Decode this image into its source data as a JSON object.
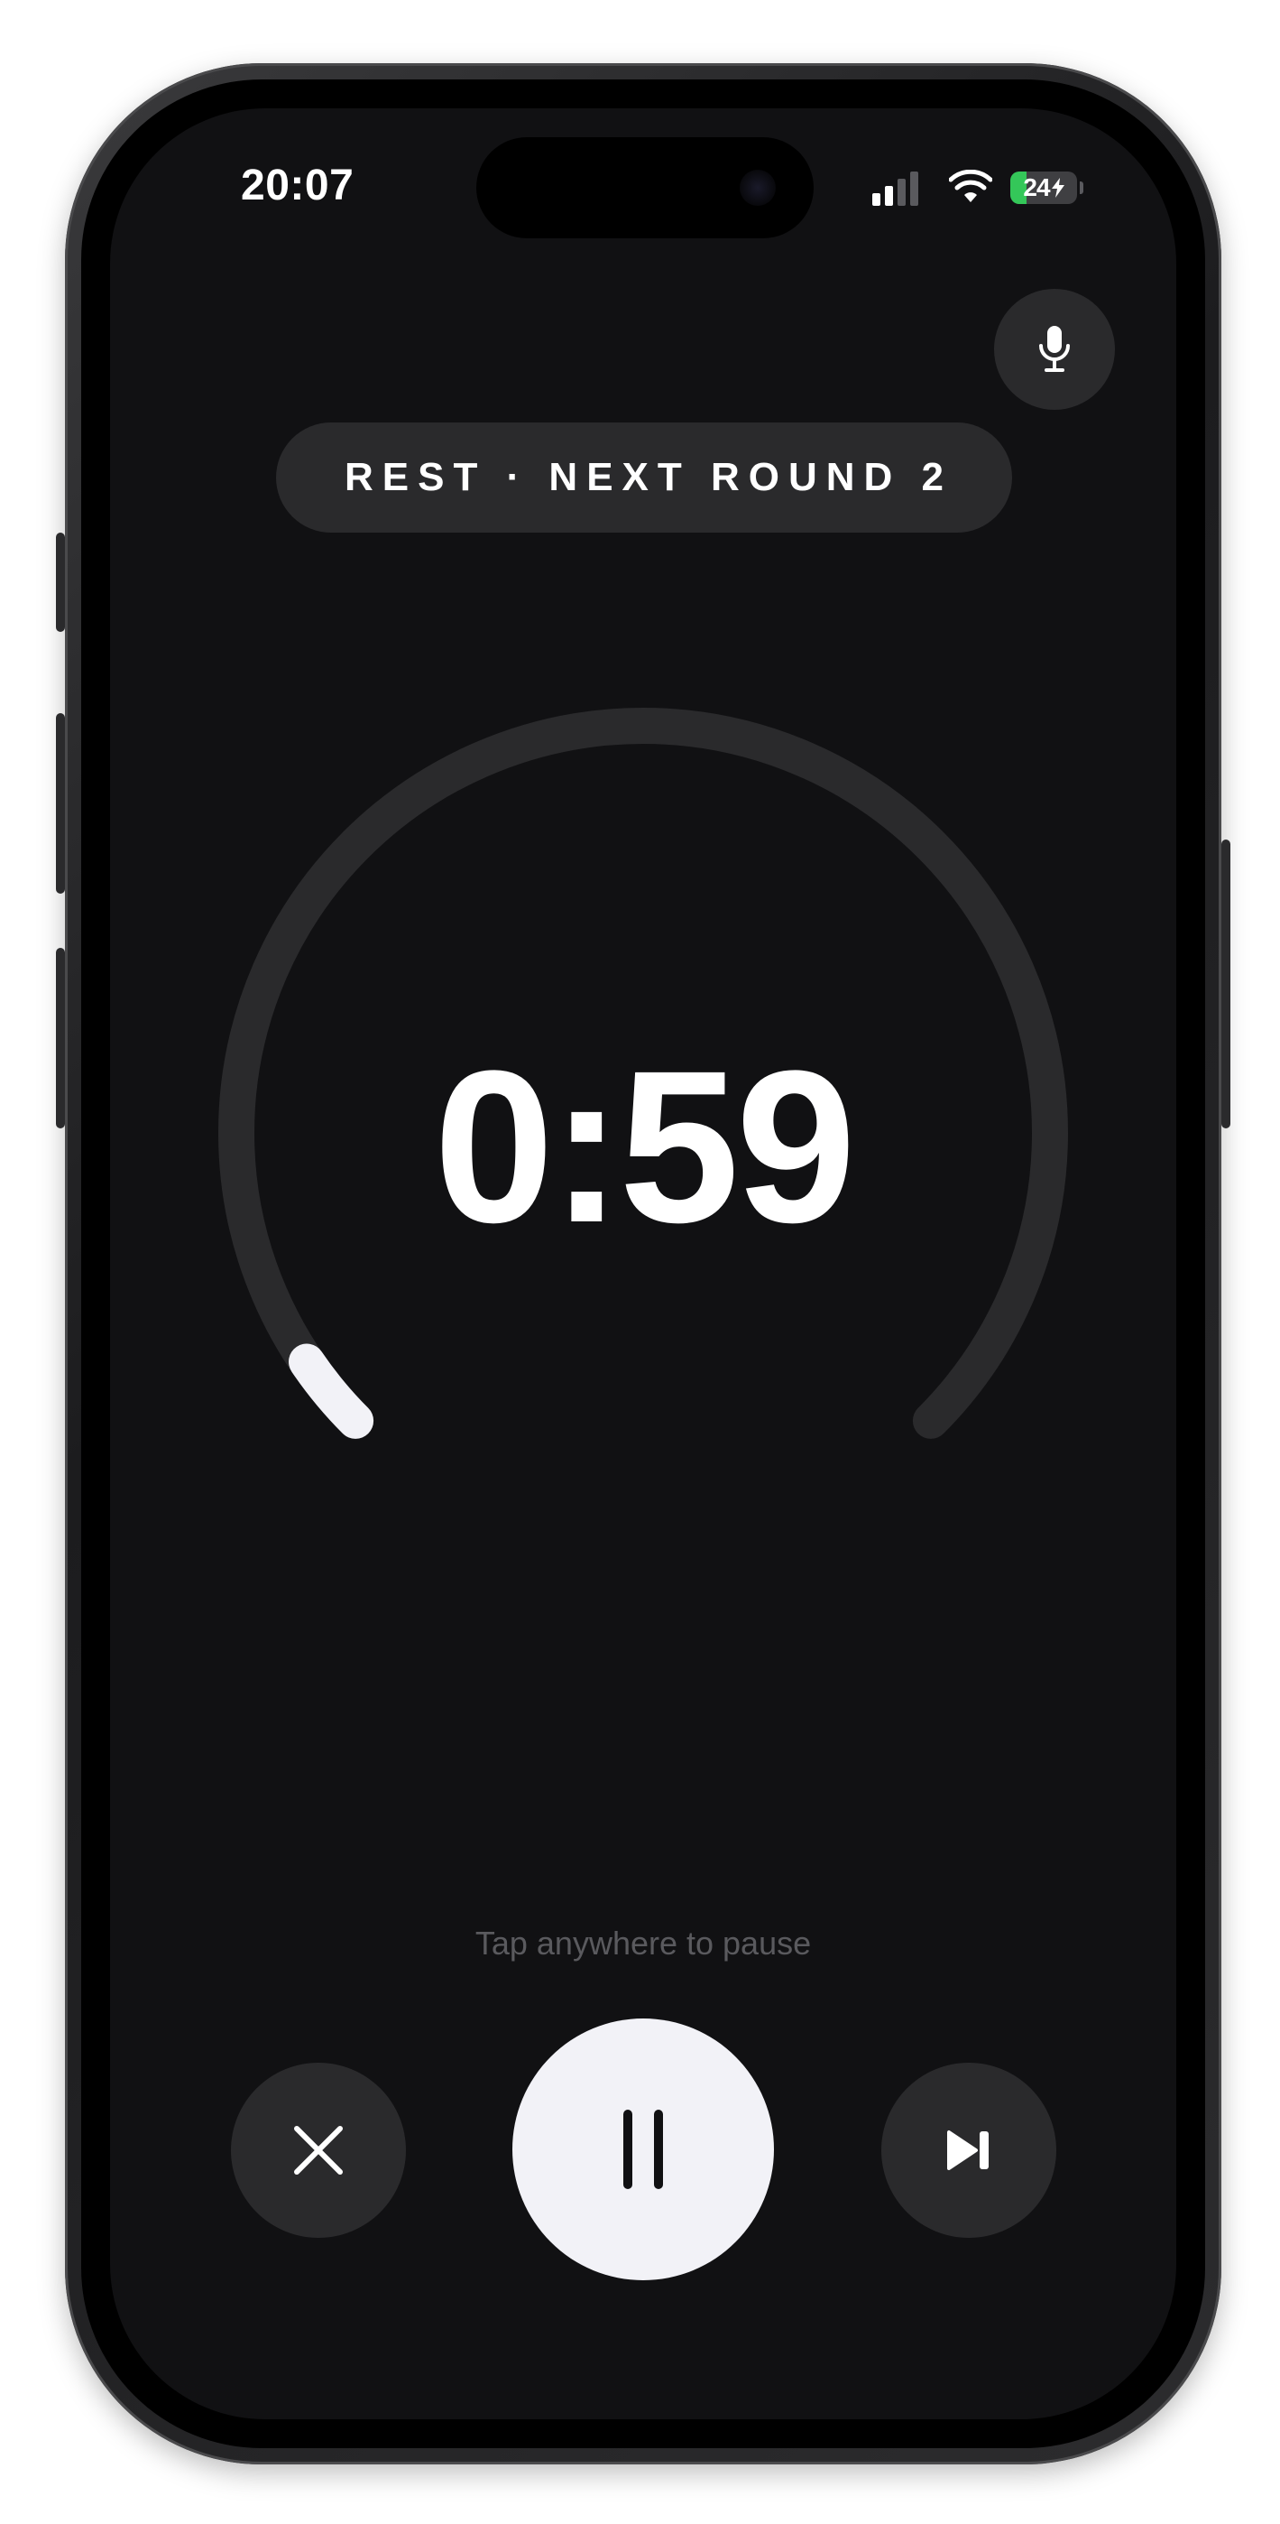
{
  "status_bar": {
    "time": "20:07",
    "battery_percent": "24",
    "battery_level": 0.24,
    "charging": true,
    "icons": [
      "cellular-signal-icon",
      "wifi-icon",
      "battery-icon"
    ]
  },
  "header": {
    "mic_icon": "microphone-icon",
    "phase_label": "REST · NEXT ROUND 2"
  },
  "timer": {
    "display": "0:59",
    "progress_fraction": 0.04
  },
  "hint": "Tap anywhere to pause",
  "controls": {
    "close_icon": "close-icon",
    "pause_icon": "pause-icon",
    "skip_icon": "skip-next-icon"
  },
  "colors": {
    "background": "#111113",
    "track": "#2a2a2c",
    "progress": "#f2f2f7",
    "text_primary": "#ffffff",
    "text_muted": "#5a5a5e",
    "battery_green": "#34c759"
  }
}
